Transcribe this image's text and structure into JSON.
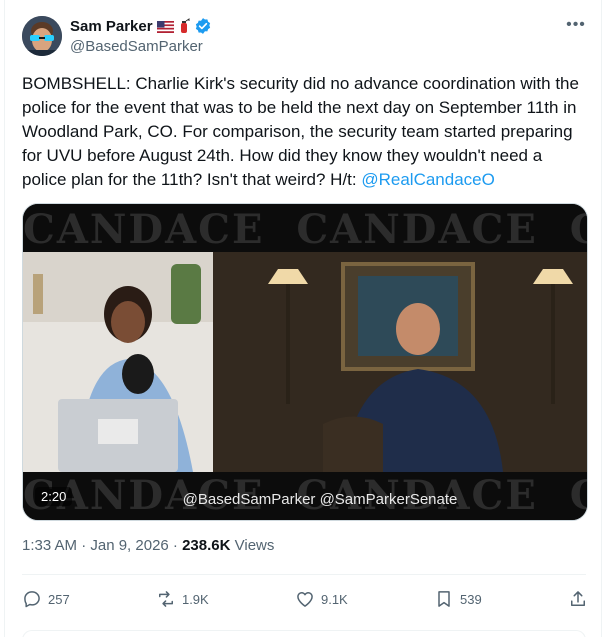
{
  "author": {
    "name": "Sam Parker",
    "handle": "@BasedSamParker",
    "flag_icon": "us-flag-icon",
    "extinguisher_icon": "fire-extinguisher-icon",
    "verified_icon": "verified-badge-icon"
  },
  "tweet": {
    "text": "BOMBSHELL: Charlie Kirk's security did no advance coordination with the police for the event that was to be held the next day on September 11th in Woodland Park, CO. For comparison, the security team started preparing for UVU before August 24th. How did they know they wouldn't need a police plan for the 11th? Isn't that weird? H/t: ",
    "mention": "@RealCandaceO"
  },
  "media": {
    "banner_word": "CANDACE",
    "duration": "2:20",
    "watermark": "@BasedSamParker @SamParkerSenate"
  },
  "meta": {
    "timestamp": "1:33 AM · Jan 9, 2026 · ",
    "views_count": "238.6K",
    "views_label": " Views"
  },
  "actions": {
    "replies": "257",
    "reposts": "1.9K",
    "likes": "9.1K",
    "bookmarks": "539"
  },
  "colors": {
    "accent": "#1d9bf0",
    "secondary_text": "#536471"
  }
}
